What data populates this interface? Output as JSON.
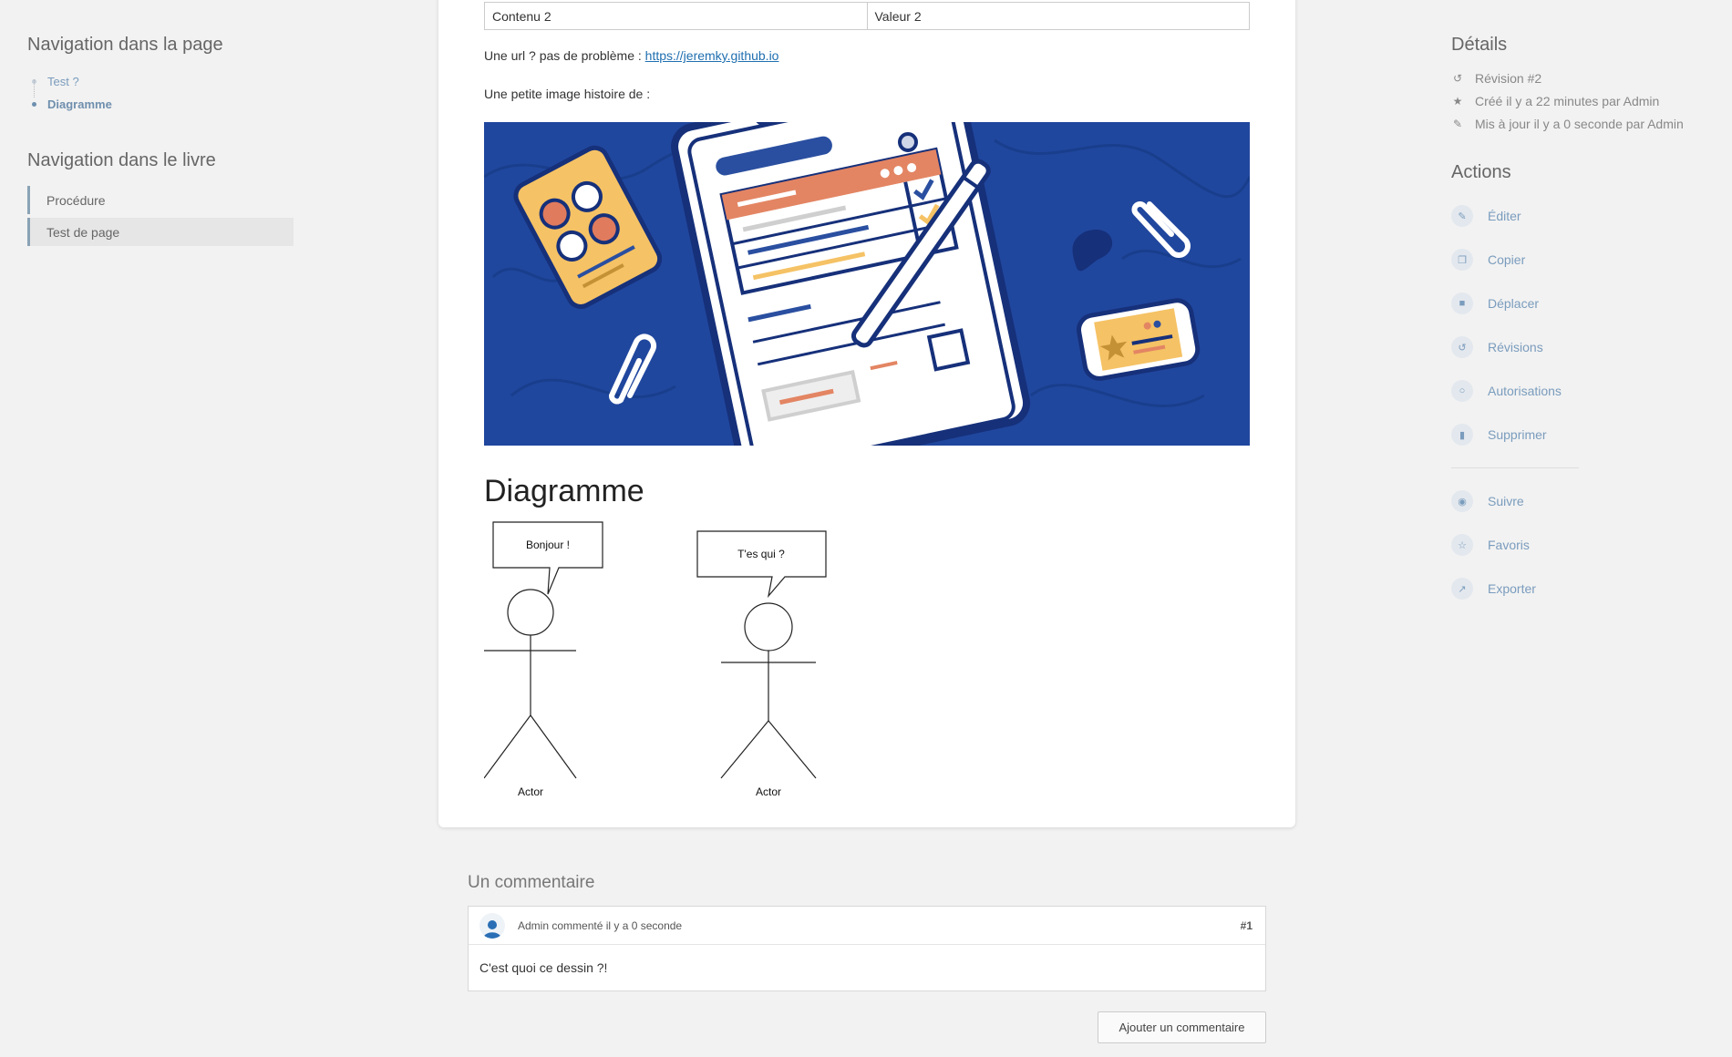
{
  "left": {
    "page_nav_title": "Navigation dans la page",
    "page_nav_items": [
      {
        "label": "Test ?"
      },
      {
        "label": "Diagramme"
      }
    ],
    "book_nav_title": "Navigation dans le livre",
    "book_nav_items": [
      {
        "label": "Procédure"
      },
      {
        "label": "Test de page"
      }
    ]
  },
  "content": {
    "table_row": [
      "Contenu 2",
      "Valeur 2"
    ],
    "url_prefix": "Une url ? pas de problème : ",
    "url_text": "https://jeremky.github.io",
    "image_intro": "Une petite image histoire de :",
    "diagram_heading": "Diagramme",
    "diagram": {
      "bubble1": "Bonjour !",
      "bubble2": "T'es qui ?",
      "actor1": "Actor",
      "actor2": "Actor"
    }
  },
  "right": {
    "details_title": "Détails",
    "details": [
      {
        "icon": "history-icon",
        "text": "Révision #2"
      },
      {
        "icon": "star-icon",
        "text": "Créé il y a 22 minutes par Admin"
      },
      {
        "icon": "pencil-icon",
        "text": "Mis à jour il y a 0 seconde par Admin"
      }
    ],
    "actions_title": "Actions",
    "actions": [
      {
        "icon": "edit-icon",
        "label": "Éditer"
      },
      {
        "icon": "copy-icon",
        "label": "Copier"
      },
      {
        "icon": "folder-icon",
        "label": "Déplacer"
      },
      {
        "icon": "history-icon",
        "label": "Révisions"
      },
      {
        "icon": "lock-icon",
        "label": "Autorisations"
      },
      {
        "icon": "trash-icon",
        "label": "Supprimer"
      }
    ],
    "secondary_actions": [
      {
        "icon": "eye-icon",
        "label": "Suivre"
      },
      {
        "icon": "star-outline-icon",
        "label": "Favoris"
      },
      {
        "icon": "export-icon",
        "label": "Exporter"
      }
    ]
  },
  "comments": {
    "title": "Un commentaire",
    "items": [
      {
        "author_line": "Admin commenté il y a 0 seconde",
        "number": "#1",
        "text": "C'est quoi ce dessin ?!"
      }
    ],
    "add_button": "Ajouter un commentaire"
  },
  "colors": {
    "accent": "#7a9cbd",
    "hero_background": "#20479e"
  }
}
